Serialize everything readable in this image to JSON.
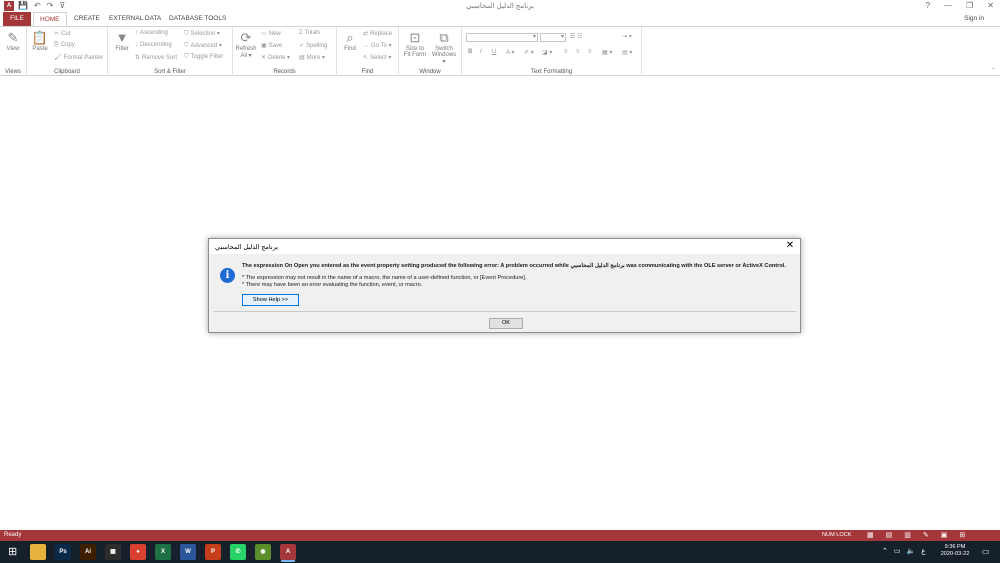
{
  "window": {
    "app_icon_letter": "A",
    "qat": [
      "💾",
      "↶",
      "↷",
      "⊽"
    ],
    "title": "برنامج الدليل المحاسبي",
    "controls": [
      "?",
      "—",
      "❐",
      "✕"
    ]
  },
  "tabs": {
    "file": "FILE",
    "home": "HOME",
    "create": "CREATE",
    "external_data": "EXTERNAL DATA",
    "database_tools": "DATABASE TOOLS",
    "sign_in": "Sign in"
  },
  "ribbon": {
    "views": {
      "label": "Views",
      "view": "View"
    },
    "clipboard": {
      "label": "Clipboard",
      "paste": "Paste",
      "cut": "Cut",
      "copy": "Copy",
      "format_painter": "Format Painter"
    },
    "sort_filter": {
      "label": "Sort & Filter",
      "filter": "Filter",
      "ascending": "Ascending",
      "descending": "Descending",
      "remove_sort": "Remove Sort",
      "selection": "Selection",
      "advanced": "Advanced",
      "toggle_filter": "Toggle Filter"
    },
    "records": {
      "label": "Records",
      "refresh": "Refresh",
      "refresh_all": "All",
      "new": "New",
      "save": "Save",
      "delete": "Delete",
      "totals": "Totals",
      "spelling": "Spelling",
      "more": "More"
    },
    "find": {
      "label": "Find",
      "find": "Find",
      "replace": "Replace",
      "goto": "Go To",
      "select": "Select"
    },
    "window": {
      "label": "Window",
      "size_to_fit": "Size to",
      "size_to_fit_2": "Fit Form",
      "switch": "Switch",
      "switch_2": "Windows"
    },
    "text_formatting": {
      "label": "Text Formatting",
      "bold": "B",
      "italic": "I",
      "underline": "U"
    }
  },
  "dialog": {
    "title": "برنامج الدليل المحاسبي",
    "message_main": "The expression On Open you entered as the event property setting produced the following error: A problem occurred while برنامج الدليل المحاسبي was communicating with the OLE server or ActiveX Control.",
    "bullet_1": "* The expression may not result in the name of a macro, the name of a user-defined function, or [Event Procedure].",
    "bullet_2": "* There may have been an error evaluating the function, event, or macro.",
    "show_help": "Show Help >>",
    "ok": "OK",
    "icon": "info-icon"
  },
  "status": {
    "text": "Ready",
    "num_lock": "NUM LOCK"
  },
  "taskbar": {
    "apps": [
      {
        "name": "file-explorer",
        "label": "",
        "color": "#e8b33c"
      },
      {
        "name": "photoshop",
        "label": "Ps",
        "color": "#0b2a4a"
      },
      {
        "name": "illustrator",
        "label": "Ai",
        "color": "#3d1f00"
      },
      {
        "name": "calculator",
        "label": "▦",
        "color": "#2d2d2d"
      },
      {
        "name": "chrome",
        "label": "●",
        "color": "#d8412f"
      },
      {
        "name": "excel",
        "label": "X",
        "color": "#1e7145"
      },
      {
        "name": "word",
        "label": "W",
        "color": "#2b579a"
      },
      {
        "name": "powerpoint",
        "label": "P",
        "color": "#c43e1c"
      },
      {
        "name": "whatsapp",
        "label": "✆",
        "color": "#25d366"
      },
      {
        "name": "app-green",
        "label": "◉",
        "color": "#5a8f29"
      },
      {
        "name": "access",
        "label": "A",
        "color": "#a4373a"
      }
    ],
    "tray_lang": "ع",
    "time": "9:36 PM",
    "date": "2020-03-22"
  }
}
